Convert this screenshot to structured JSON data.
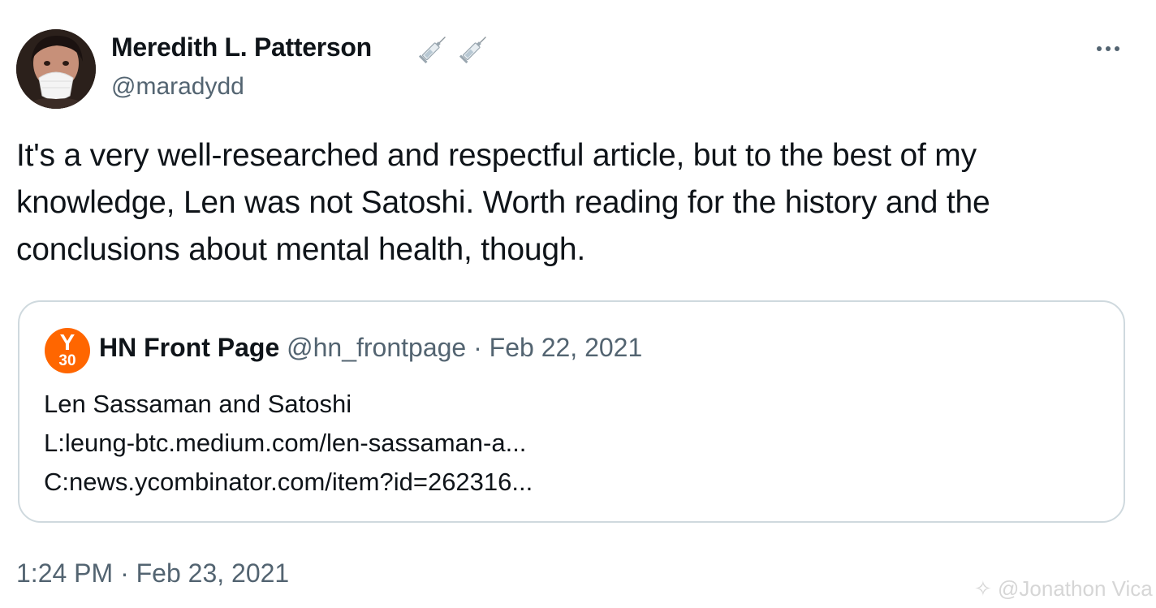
{
  "author": {
    "name": "Meredith L. Patterson",
    "handle": "@maradydd",
    "name_emoji_icons": [
      "syringe-icon",
      "syringe-icon"
    ]
  },
  "tweet": {
    "text": "It's a very well-researched and respectful article, but to the best of my knowledge, Len was not Satoshi. Worth reading for the history and the conclusions about mental health, though.",
    "timestamp": "1:24 PM · Feb 23, 2021"
  },
  "quote": {
    "avatar_letter": "Y",
    "avatar_number": "30",
    "avatar_color": "#ff6600",
    "name": "HN Front Page",
    "handle": "@hn_frontpage",
    "separator": " · ",
    "date": "Feb 22, 2021",
    "lines": [
      "Len Sassaman and Satoshi",
      "L:leung-btc.medium.com/len-sassaman-a...",
      "C:news.ycombinator.com/item?id=262316..."
    ]
  },
  "more_button_icon": "more-horizontal-icon",
  "watermark": "@Jonathon Vica",
  "colors": {
    "text_primary": "#0f1419",
    "text_secondary": "#536471",
    "border": "#cfd9de"
  }
}
